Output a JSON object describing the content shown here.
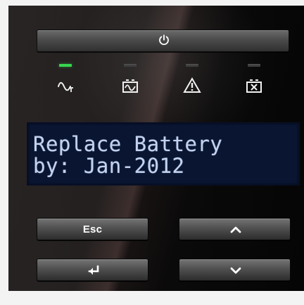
{
  "lcd": {
    "line1": "Replace Battery",
    "line2": "by: Jan-2012"
  },
  "buttons": {
    "power_icon": "power-icon",
    "esc_label": "Esc",
    "up_icon": "chevron-up-icon",
    "enter_icon": "enter-arrow-icon",
    "down_icon": "chevron-down-icon"
  },
  "indicators": [
    {
      "icon": "ac-wave-icon",
      "status": "on",
      "color": "#38d84f"
    },
    {
      "icon": "battery-status-icon",
      "status": "off",
      "color": "#3f3f3f"
    },
    {
      "icon": "warning-icon",
      "status": "off",
      "color": "#3f3f3f"
    },
    {
      "icon": "battery-fault-icon",
      "status": "off",
      "color": "#3f3f3f"
    }
  ],
  "colors": {
    "panel": "#090808",
    "lcd_background": "#0a1532",
    "lcd_text": "#c3d2ee",
    "button_text": "#ffffff"
  }
}
